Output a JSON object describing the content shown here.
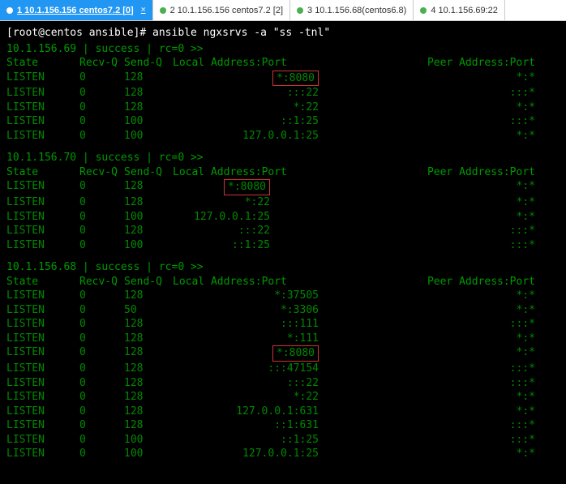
{
  "tabs": [
    {
      "label": "1 10.1.156.156 centos7.2 [0]",
      "active": true,
      "close": true
    },
    {
      "label": "2 10.1.156.156 centos7.2 [2]",
      "active": false,
      "close": false
    },
    {
      "label": "3 10.1.156.68(centos6.8)",
      "active": false,
      "close": false
    },
    {
      "label": "4 10.1.156.69:22",
      "active": false,
      "close": false
    }
  ],
  "prompt": "[root@centos ansible]# ansible ngxsrvs -a \"ss -tnl\"",
  "header_cols": {
    "state": "State",
    "recvq": "Recv-Q",
    "sendq": "Send-Q",
    "local": "Local Address:Port",
    "peer": "Peer Address:Port"
  },
  "hosts": [
    {
      "header": "10.1.156.69 | success | rc=0 >>",
      "layout": "wide",
      "rows": [
        {
          "state": "LISTEN",
          "recvq": "0",
          "sendq": "128",
          "local": "*:8080",
          "peer": "*:*",
          "hl": true
        },
        {
          "state": "LISTEN",
          "recvq": "0",
          "sendq": "128",
          "local": ":::22",
          "peer": ":::*",
          "hl": false
        },
        {
          "state": "LISTEN",
          "recvq": "0",
          "sendq": "128",
          "local": "*:22",
          "peer": "*:*",
          "hl": false
        },
        {
          "state": "LISTEN",
          "recvq": "0",
          "sendq": "100",
          "local": "::1:25",
          "peer": ":::*",
          "hl": false
        },
        {
          "state": "LISTEN",
          "recvq": "0",
          "sendq": "100",
          "local": "127.0.0.1:25",
          "peer": "*:*",
          "hl": false
        }
      ]
    },
    {
      "header": "10.1.156.70 | success | rc=0 >>",
      "layout": "narrow",
      "rows": [
        {
          "state": "LISTEN",
          "recvq": "0",
          "sendq": "128",
          "local": "*:8080",
          "peer": "*:*",
          "hl": true
        },
        {
          "state": "LISTEN",
          "recvq": "0",
          "sendq": "128",
          "local": "*:22",
          "peer": "*:*",
          "hl": false
        },
        {
          "state": "LISTEN",
          "recvq": "0",
          "sendq": "100",
          "local": "127.0.0.1:25",
          "peer": "*:*",
          "hl": false
        },
        {
          "state": "LISTEN",
          "recvq": "0",
          "sendq": "128",
          "local": ":::22",
          "peer": ":::*",
          "hl": false
        },
        {
          "state": "LISTEN",
          "recvq": "0",
          "sendq": "100",
          "local": "::1:25",
          "peer": ":::*",
          "hl": false
        }
      ]
    },
    {
      "header": "10.1.156.68 | success | rc=0 >>",
      "layout": "wide",
      "rows": [
        {
          "state": "LISTEN",
          "recvq": "0",
          "sendq": "128",
          "local": "*:37505",
          "peer": "*:*",
          "hl": false
        },
        {
          "state": "LISTEN",
          "recvq": "0",
          "sendq": "50",
          "local": "*:3306",
          "peer": "*:*",
          "hl": false
        },
        {
          "state": "LISTEN",
          "recvq": "0",
          "sendq": "128",
          "local": ":::111",
          "peer": ":::*",
          "hl": false
        },
        {
          "state": "LISTEN",
          "recvq": "0",
          "sendq": "128",
          "local": "*:111",
          "peer": "*:*",
          "hl": false
        },
        {
          "state": "LISTEN",
          "recvq": "0",
          "sendq": "128",
          "local": "*:8080",
          "peer": "*:*",
          "hl": true
        },
        {
          "state": "LISTEN",
          "recvq": "0",
          "sendq": "128",
          "local": ":::47154",
          "peer": ":::*",
          "hl": false
        },
        {
          "state": "LISTEN",
          "recvq": "0",
          "sendq": "128",
          "local": ":::22",
          "peer": ":::*",
          "hl": false
        },
        {
          "state": "LISTEN",
          "recvq": "0",
          "sendq": "128",
          "local": "*:22",
          "peer": "*:*",
          "hl": false
        },
        {
          "state": "LISTEN",
          "recvq": "0",
          "sendq": "128",
          "local": "127.0.0.1:631",
          "peer": "*:*",
          "hl": false
        },
        {
          "state": "LISTEN",
          "recvq": "0",
          "sendq": "128",
          "local": "::1:631",
          "peer": ":::*",
          "hl": false
        },
        {
          "state": "LISTEN",
          "recvq": "0",
          "sendq": "100",
          "local": "::1:25",
          "peer": ":::*",
          "hl": false
        },
        {
          "state": "LISTEN",
          "recvq": "0",
          "sendq": "100",
          "local": "127.0.0.1:25",
          "peer": "*:*",
          "hl": false
        }
      ]
    }
  ]
}
